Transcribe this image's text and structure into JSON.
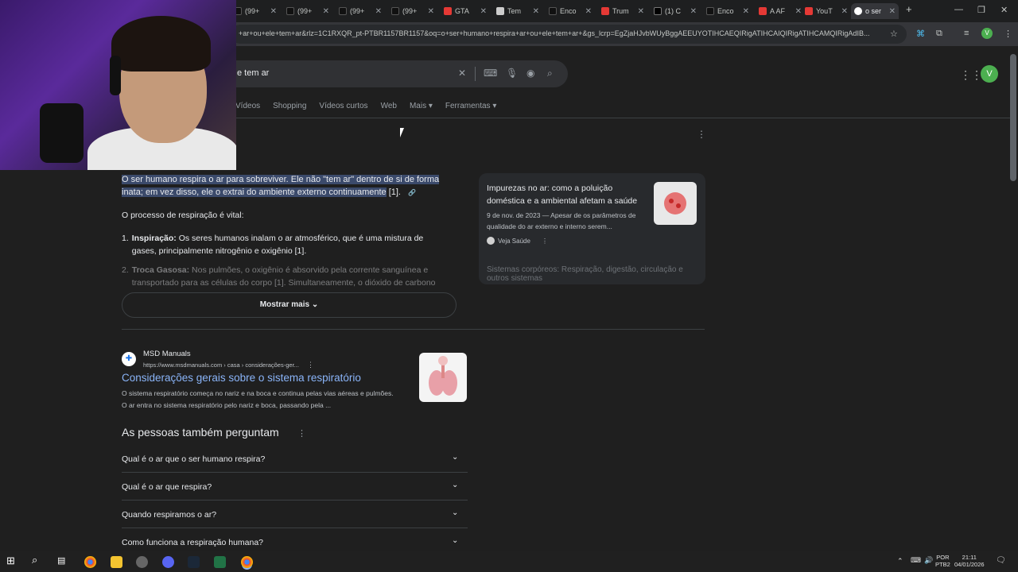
{
  "tabs": [
    {
      "label": "(99+"
    },
    {
      "label": "(99+"
    },
    {
      "label": "(99+"
    },
    {
      "label": "(99+"
    },
    {
      "label": "GTA"
    },
    {
      "label": "Tem"
    },
    {
      "label": "Enco"
    },
    {
      "label": "Trum"
    },
    {
      "label": "(1) C"
    },
    {
      "label": "Enco"
    },
    {
      "label": "A AF"
    },
    {
      "label": "YouT"
    },
    {
      "label": "o ser"
    }
  ],
  "tab_close": "✕",
  "new_tab": "+",
  "window": {
    "minimize": "—",
    "maximize": "❐",
    "close": "✕"
  },
  "address": {
    "url": "+ar+ou+ele+tem+ar&rlz=1C1RXQR_pt-PTBR1157BR1157&oq=o+ser+humano+respira+ar+ou+ele+tem+ar+&gs_lcrp=EgZjaHJvbWUyBggAEEUYOTIHCAEQIRigATIHCAIQIRigATIHCAMQIRigAdIB...",
    "profile": "V"
  },
  "search": {
    "query": "e tem ar"
  },
  "nav_tabs": [
    "Vídeos",
    "Shopping",
    "Vídeos curtos",
    "Web",
    "Mais ▾",
    "Ferramentas ▾"
  ],
  "answer": {
    "highlight": "O ser humano respira o ar para sobreviver. Ele não \"tem ar\" dentro de si de forma inata; em vez disso, ele o extrai do ambiente externo continuamente",
    "cite": " [1].",
    "process": "O processo de respiração é vital:",
    "items": [
      {
        "num": "1.",
        "bold": "Inspiração:",
        "text": " Os seres humanos inalam o ar atmosférico, que é uma mistura de gases, principalmente nitrogênio e oxigênio [1]."
      },
      {
        "num": "2.",
        "bold": "Troca Gasosa:",
        "text": " Nos pulmões, o oxigênio é absorvido pela corrente sanguínea e transportado para as células do corpo [1]. Simultaneamente, o dióxido de carbono"
      }
    ],
    "show_more": "Mostrar mais"
  },
  "source_card": {
    "title": "Impurezas no ar: como a poluição doméstica e a ambiental afetam a saúde",
    "date": "9 de nov. de 2023 — Apesar de os parâmetros de qualidade do ar externo e interno serem...",
    "site": "Veja Saúde",
    "next": "Sistemas corpóreos: Respiração, digestão, circulação e outros sistemas"
  },
  "result": {
    "site": "MSD Manuals",
    "url": "https://www.msdmanuals.com › casa › considerações-ger...",
    "title": "Considerações gerais sobre o sistema respiratório",
    "snippet": "O sistema respiratório começa no nariz e na boca e continua pelas vias aéreas e pulmões. O ar entra no sistema respiratório pelo nariz e boca, passando pela ..."
  },
  "paa": {
    "title": "As pessoas também perguntam",
    "questions": [
      "Qual é o ar que o ser humano respira?",
      "Qual é o ar que respira?",
      "Quando respiramos o ar?",
      "Como funciona a respiração humana?"
    ]
  },
  "taskbar": {
    "lang": "POR",
    "layout": "PTB2",
    "time": "21:11",
    "date": "04/01/2026"
  },
  "colors": {
    "accent": "#8ab4f8",
    "highlight": "#3b4a6b",
    "profile": "#4caf50"
  }
}
